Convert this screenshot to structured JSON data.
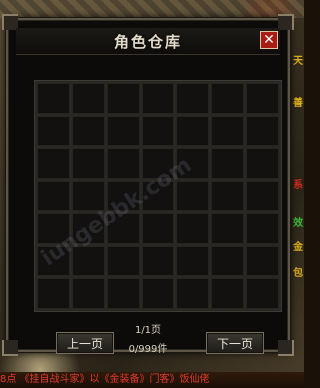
{
  "window": {
    "title": "角色仓库",
    "close_label": "✕"
  },
  "grid": {
    "rows": 7,
    "cols": 7
  },
  "pagination": {
    "page_text": "1/1页",
    "count_text": "0/999件",
    "prev_label": "上一页",
    "next_label": "下一页"
  },
  "watermark": {
    "text": "iungebbk.com"
  },
  "side_text": {
    "chars": [
      "天",
      "善",
      "系",
      "效",
      "金",
      "包"
    ]
  },
  "bottom_strip": {
    "text": "8点 《挂自战斗家》以《金装备》门客》饭仙佬"
  },
  "colors": {
    "close_red": "#a81c14",
    "frame": "#5d5546",
    "cell_bg": "#121110"
  }
}
